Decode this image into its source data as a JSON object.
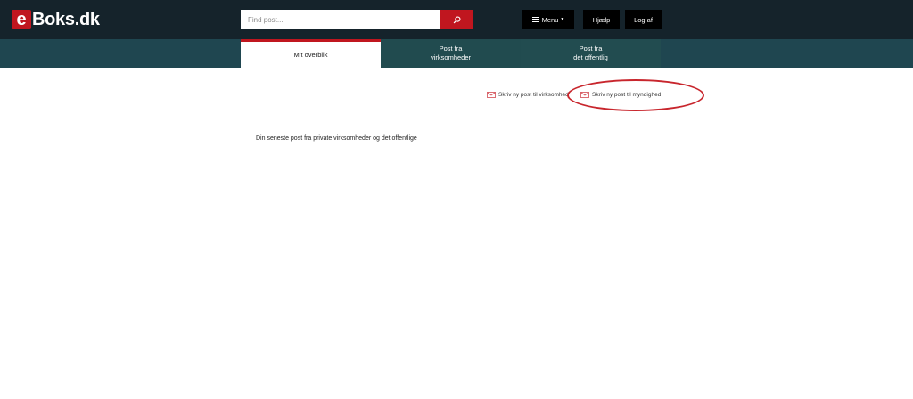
{
  "header": {
    "logo_letter": "e",
    "logo_text": "Boks.dk",
    "search_placeholder": "Find post...",
    "menu_label": "Menu",
    "help_label": "Hjælp",
    "logout_label": "Log af"
  },
  "tabs": [
    {
      "label": "Mit overblik",
      "active": true
    },
    {
      "label": "Post fra\nvirksomheder",
      "active": false
    },
    {
      "label": "Post fra\ndet offentlig",
      "active": false
    }
  ],
  "actions": {
    "write_company": "Skriv ny post til virksomhed",
    "write_authority": "Skriv ny post til myndighed"
  },
  "main": {
    "heading": "Din seneste post fra private virksomheder og det offentlige"
  },
  "colors": {
    "header_bg": "#15232b",
    "tabbar_bg": "#1f4650",
    "accent_red": "#c0161f",
    "highlight_ring": "#c8262d"
  }
}
